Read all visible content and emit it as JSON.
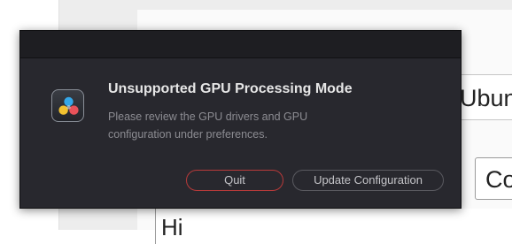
{
  "background": {
    "field_1_text": "Ubuntu",
    "field_2_text": "Co",
    "text_area_text": "Hi"
  },
  "dialog": {
    "icon": "davinci-resolve-icon",
    "title": "Unsupported GPU Processing Mode",
    "message": "Please review the GPU drivers and GPU configuration under preferences.",
    "buttons": {
      "quit_label": "Quit",
      "update_label": "Update Configuration"
    },
    "colors": {
      "background": "#28282e",
      "titlebar": "#1e1e22",
      "quit_border": "#b83a3a"
    }
  }
}
